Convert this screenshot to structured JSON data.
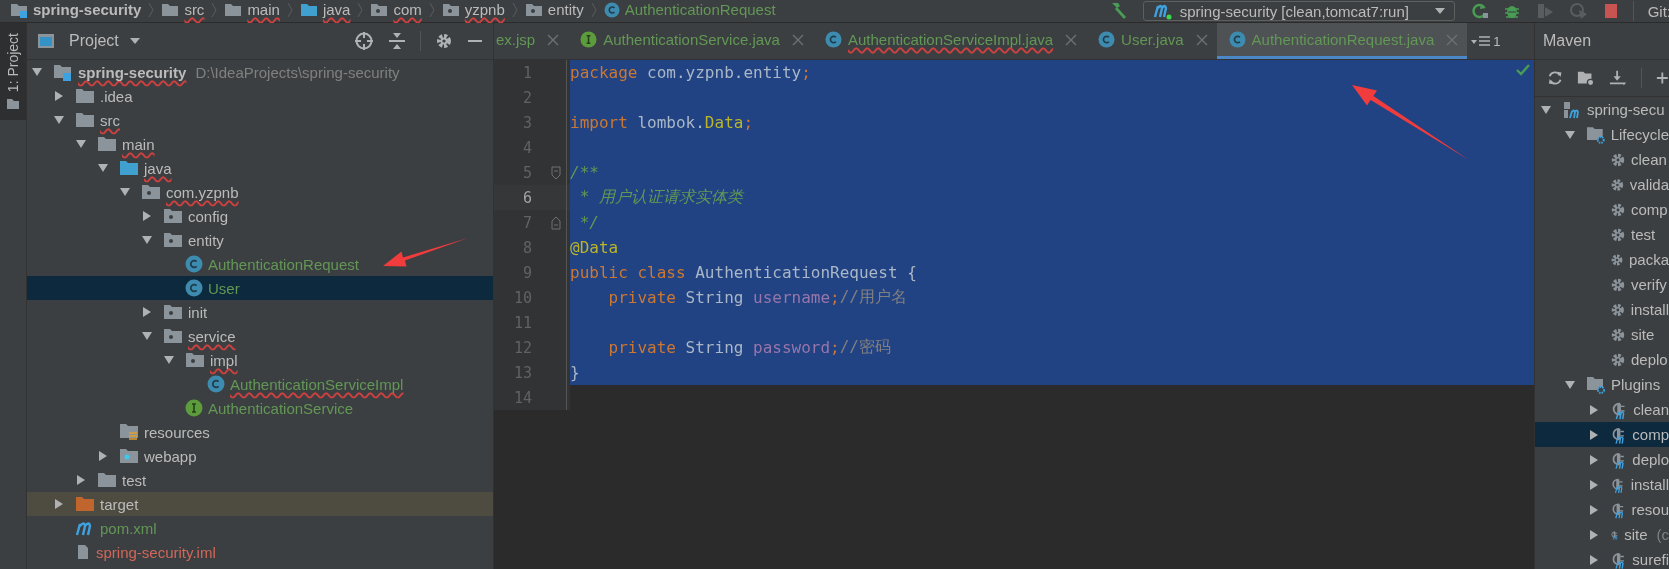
{
  "breadcrumbs": [
    {
      "label": "spring-security",
      "kind": "module",
      "typo": false
    },
    {
      "label": "src",
      "kind": "folder",
      "typo": true
    },
    {
      "label": "main",
      "kind": "folder",
      "typo": true
    },
    {
      "label": "java",
      "kind": "source-folder",
      "typo": true
    },
    {
      "label": "com",
      "kind": "package",
      "typo": true
    },
    {
      "label": "yzpnb",
      "kind": "package",
      "typo": true
    },
    {
      "label": "entity",
      "kind": "package",
      "typo": false
    },
    {
      "label": "AuthenticationRequest",
      "kind": "class",
      "typo": false
    }
  ],
  "run_config": {
    "label": "spring-security [clean,tomcat7:run]"
  },
  "vcs_label": "Git:",
  "side_tab": {
    "label": "1: Project",
    "selected": true
  },
  "project": {
    "title": "Project",
    "tree": [
      {
        "label": "spring-security",
        "hint": "D:\\IdeaProjects\\spring-security",
        "kind": "module",
        "expanded": true,
        "selected": false,
        "typo": true,
        "children": [
          {
            "label": ".idea",
            "kind": "folder",
            "expanded": false,
            "selected": false
          },
          {
            "label": "src",
            "kind": "folder",
            "expanded": true,
            "selected": false,
            "typo": true,
            "children": [
              {
                "label": "main",
                "kind": "folder",
                "expanded": true,
                "selected": false,
                "typo": true,
                "children": [
                  {
                    "label": "java",
                    "kind": "source-folder",
                    "expanded": true,
                    "selected": false,
                    "typo": true,
                    "children": [
                      {
                        "label": "com.yzpnb",
                        "kind": "package",
                        "expanded": true,
                        "selected": false,
                        "typo": true,
                        "children": [
                          {
                            "label": "config",
                            "kind": "package",
                            "expanded": false,
                            "selected": false
                          },
                          {
                            "label": "entity",
                            "kind": "package",
                            "expanded": true,
                            "selected": false,
                            "children": [
                              {
                                "label": "AuthenticationRequest",
                                "kind": "class",
                                "selected": false,
                                "color": "#629755"
                              },
                              {
                                "label": "User",
                                "kind": "class",
                                "selected": true,
                                "color": "#629755"
                              }
                            ]
                          },
                          {
                            "label": "init",
                            "kind": "package",
                            "expanded": false,
                            "selected": false
                          },
                          {
                            "label": "service",
                            "kind": "package",
                            "expanded": true,
                            "selected": false,
                            "typo": true,
                            "children": [
                              {
                                "label": "impl",
                                "kind": "package",
                                "expanded": true,
                                "selected": false,
                                "typo": true,
                                "children": [
                                  {
                                    "label": "AuthenticationServiceImpl",
                                    "kind": "class",
                                    "selected": false,
                                    "color": "#629755",
                                    "typo": true
                                  }
                                ]
                              },
                              {
                                "label": "AuthenticationService",
                                "kind": "interface",
                                "selected": false,
                                "color": "#629755"
                              }
                            ]
                          }
                        ]
                      }
                    ]
                  },
                  {
                    "label": "resources",
                    "kind": "resources",
                    "selected": false
                  },
                  {
                    "label": "webapp",
                    "kind": "webapp",
                    "expanded": false,
                    "selected": false
                  }
                ]
              },
              {
                "label": "test",
                "kind": "folder",
                "expanded": false,
                "selected": false
              }
            ]
          },
          {
            "label": "target",
            "kind": "excluded",
            "expanded": false,
            "selected": false
          },
          {
            "label": "pom.xml",
            "kind": "maven-file",
            "selected": false,
            "color": "#629755"
          },
          {
            "label": "spring-security.iml",
            "kind": "iml",
            "selected": false,
            "color": "#d1675a"
          }
        ]
      }
    ]
  },
  "editor": {
    "tabs": [
      {
        "label": "ex.jsp",
        "kind": "jsp",
        "selected": false,
        "typo": false
      },
      {
        "label": "AuthenticationService.java",
        "kind": "interface",
        "selected": false,
        "typo": false
      },
      {
        "label": "AuthenticationServiceImpl.java",
        "kind": "class",
        "selected": false,
        "typo": true
      },
      {
        "label": "User.java",
        "kind": "class",
        "selected": false,
        "typo": false
      },
      {
        "label": "AuthenticationRequest.java",
        "kind": "class",
        "selected": true,
        "typo": false
      }
    ],
    "hidden_tabs_count": "1",
    "lines": [
      {
        "number": "1",
        "selected": true,
        "caret": false,
        "tokens": [
          {
            "kind": "keyword",
            "text": "package"
          },
          {
            "kind": "plain",
            "text": " com.yzpnb.entity"
          },
          {
            "kind": "keyword",
            "text": ";"
          }
        ]
      },
      {
        "number": "2",
        "selected": true,
        "caret": false
      },
      {
        "number": "3",
        "selected": true,
        "caret": false,
        "tokens": [
          {
            "kind": "keyword",
            "text": "import"
          },
          {
            "kind": "plain",
            "text": " lombok."
          },
          {
            "kind": "annotation",
            "text": "Data"
          },
          {
            "kind": "keyword",
            "text": ";"
          }
        ]
      },
      {
        "number": "4",
        "selected": true,
        "caret": false
      },
      {
        "number": "5",
        "selected": true,
        "caret": false,
        "kind": "fold-start",
        "tokens": [
          {
            "kind": "doc",
            "text": "/**"
          }
        ]
      },
      {
        "number": "6",
        "selected": true,
        "caret": true,
        "tokens": [
          {
            "kind": "doc",
            "text": " * 用户认证请求实体类"
          }
        ]
      },
      {
        "number": "7",
        "selected": true,
        "caret": false,
        "kind": "fold-end",
        "tokens": [
          {
            "kind": "doc",
            "text": " */"
          }
        ]
      },
      {
        "number": "8",
        "selected": true,
        "caret": false,
        "tokens": [
          {
            "kind": "annotation",
            "text": "@Data"
          }
        ]
      },
      {
        "number": "9",
        "selected": true,
        "caret": false,
        "tokens": [
          {
            "kind": "keyword",
            "text": "public class"
          },
          {
            "kind": "plain",
            "text": " AuthenticationRequest {"
          }
        ]
      },
      {
        "number": "10",
        "selected": true,
        "caret": false,
        "tokens": [
          {
            "kind": "keyword",
            "text": "    private"
          },
          {
            "kind": "plain",
            "text": " String "
          },
          {
            "kind": "field",
            "text": "username"
          },
          {
            "kind": "keyword",
            "text": ";"
          },
          {
            "kind": "comment",
            "text": "//用户名"
          }
        ]
      },
      {
        "number": "11",
        "selected": true,
        "caret": false
      },
      {
        "number": "12",
        "selected": true,
        "caret": false,
        "tokens": [
          {
            "kind": "keyword",
            "text": "    private"
          },
          {
            "kind": "plain",
            "text": " String "
          },
          {
            "kind": "field",
            "text": "password"
          },
          {
            "kind": "keyword",
            "text": ";"
          },
          {
            "kind": "comment",
            "text": "//密码"
          }
        ]
      },
      {
        "number": "13",
        "selected": true,
        "caret": false,
        "tokens": [
          {
            "kind": "plain",
            "text": "}"
          }
        ]
      },
      {
        "number": "14",
        "selected": false,
        "caret": false
      }
    ]
  },
  "maven": {
    "title": "Maven",
    "tree": [
      {
        "label": "spring-secu",
        "kind": "maven-project",
        "expanded": true,
        "selected": false,
        "children": [
          {
            "label": "Lifecycle",
            "kind": "folder",
            "expanded": true,
            "selected": false,
            "children": [
              {
                "label": "clean",
                "kind": "goal",
                "selected": false
              },
              {
                "label": "valida",
                "kind": "goal",
                "selected": false
              },
              {
                "label": "comp",
                "kind": "goal",
                "selected": false
              },
              {
                "label": "test",
                "kind": "goal",
                "selected": false
              },
              {
                "label": "packa",
                "kind": "goal",
                "selected": false
              },
              {
                "label": "verify",
                "kind": "goal",
                "selected": false
              },
              {
                "label": "install",
                "kind": "goal",
                "selected": false
              },
              {
                "label": "site",
                "kind": "goal",
                "selected": false
              },
              {
                "label": "deplo",
                "kind": "goal",
                "selected": false
              }
            ]
          },
          {
            "label": "Plugins",
            "kind": "folder",
            "expanded": true,
            "selected": false,
            "children": [
              {
                "label": "clean",
                "kind": "plugin",
                "expanded": false,
                "selected": false
              },
              {
                "label": "comp",
                "kind": "plugin",
                "expanded": false,
                "selected": true
              },
              {
                "label": "deplo",
                "kind": "plugin",
                "expanded": false,
                "selected": false
              },
              {
                "label": "install",
                "kind": "plugin",
                "expanded": false,
                "selected": false
              },
              {
                "label": "resou",
                "kind": "plugin",
                "expanded": false,
                "selected": false
              },
              {
                "label": "site",
                "hint": "(c",
                "kind": "plugin",
                "expanded": false,
                "selected": false
              },
              {
                "label": "surefi",
                "kind": "plugin",
                "expanded": false,
                "selected": false
              }
            ]
          }
        ]
      }
    ]
  }
}
